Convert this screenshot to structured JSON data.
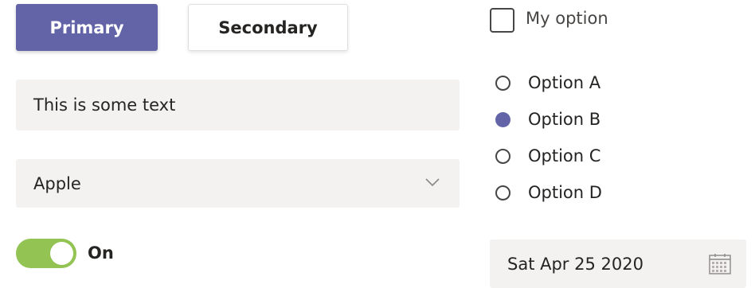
{
  "buttons": {
    "primary_label": "Primary",
    "secondary_label": "Secondary"
  },
  "text_input": {
    "value": "This is some text"
  },
  "dropdown": {
    "selected": "Apple",
    "icon": "chevron-down-icon"
  },
  "toggle": {
    "state": "on",
    "label": "On"
  },
  "checkbox": {
    "label": "My option",
    "checked": false
  },
  "radio_group": {
    "options": [
      "Option A",
      "Option B",
      "Option C",
      "Option D"
    ],
    "selected": "Option B"
  },
  "date_picker": {
    "value": "Sat Apr 25 2020",
    "icon": "calendar-icon"
  },
  "colors": {
    "brand": "#6264a7",
    "toggle_on": "#92c353",
    "field_bg": "#f3f2f1",
    "text": "#252423"
  }
}
